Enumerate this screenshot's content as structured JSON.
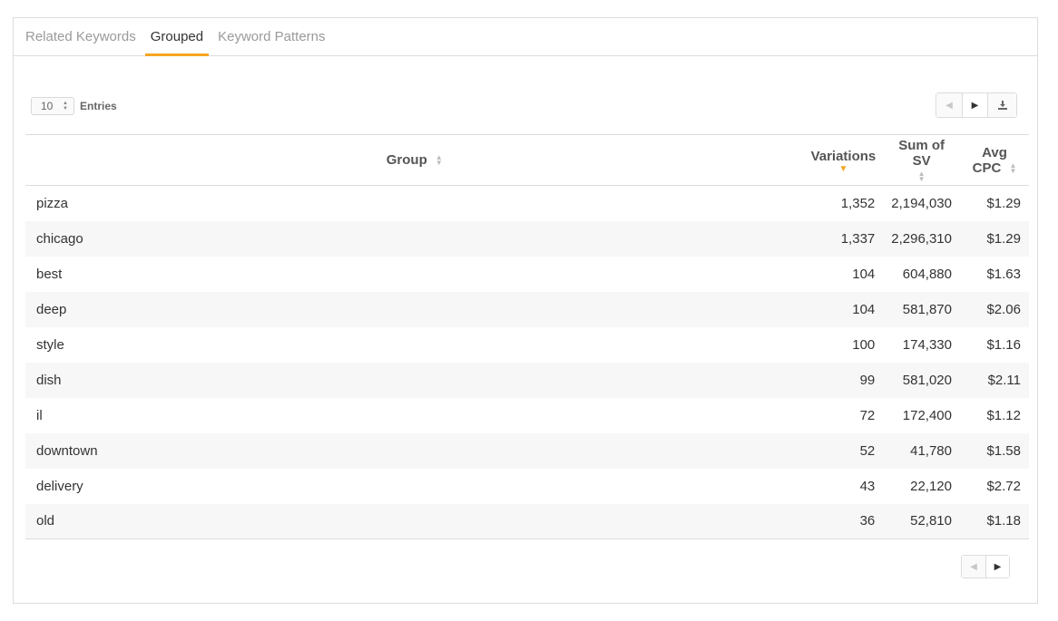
{
  "tabs": [
    {
      "label": "Related Keywords",
      "active": false
    },
    {
      "label": "Grouped",
      "active": true
    },
    {
      "label": "Keyword Patterns",
      "active": false
    }
  ],
  "toolbar": {
    "entries_value": "10",
    "entries_label": "Entries",
    "prev_icon": "caret-left-icon",
    "next_icon": "caret-right-icon",
    "download_icon": "download-icon"
  },
  "table": {
    "columns": [
      "Group",
      "Variations",
      "Sum of SV",
      "Avg CPC"
    ],
    "sorted_column": "Variations",
    "sort_direction": "descending",
    "rows": [
      {
        "group": "pizza",
        "variations": "1,352",
        "sum_sv": "2,194,030",
        "avg_cpc": "$1.29"
      },
      {
        "group": "chicago",
        "variations": "1,337",
        "sum_sv": "2,296,310",
        "avg_cpc": "$1.29"
      },
      {
        "group": "best",
        "variations": "104",
        "sum_sv": "604,880",
        "avg_cpc": "$1.63"
      },
      {
        "group": "deep",
        "variations": "104",
        "sum_sv": "581,870",
        "avg_cpc": "$2.06"
      },
      {
        "group": "style",
        "variations": "100",
        "sum_sv": "174,330",
        "avg_cpc": "$1.16"
      },
      {
        "group": "dish",
        "variations": "99",
        "sum_sv": "581,020",
        "avg_cpc": "$2.11"
      },
      {
        "group": "il",
        "variations": "72",
        "sum_sv": "172,400",
        "avg_cpc": "$1.12"
      },
      {
        "group": "downtown",
        "variations": "52",
        "sum_sv": "41,780",
        "avg_cpc": "$1.58"
      },
      {
        "group": "delivery",
        "variations": "43",
        "sum_sv": "22,120",
        "avg_cpc": "$2.72"
      },
      {
        "group": "old",
        "variations": "36",
        "sum_sv": "52,810",
        "avg_cpc": "$1.18"
      }
    ]
  },
  "colors": {
    "accent": "#f5a623",
    "border": "#dcdcdc",
    "stripe": "#f7f7f7"
  }
}
